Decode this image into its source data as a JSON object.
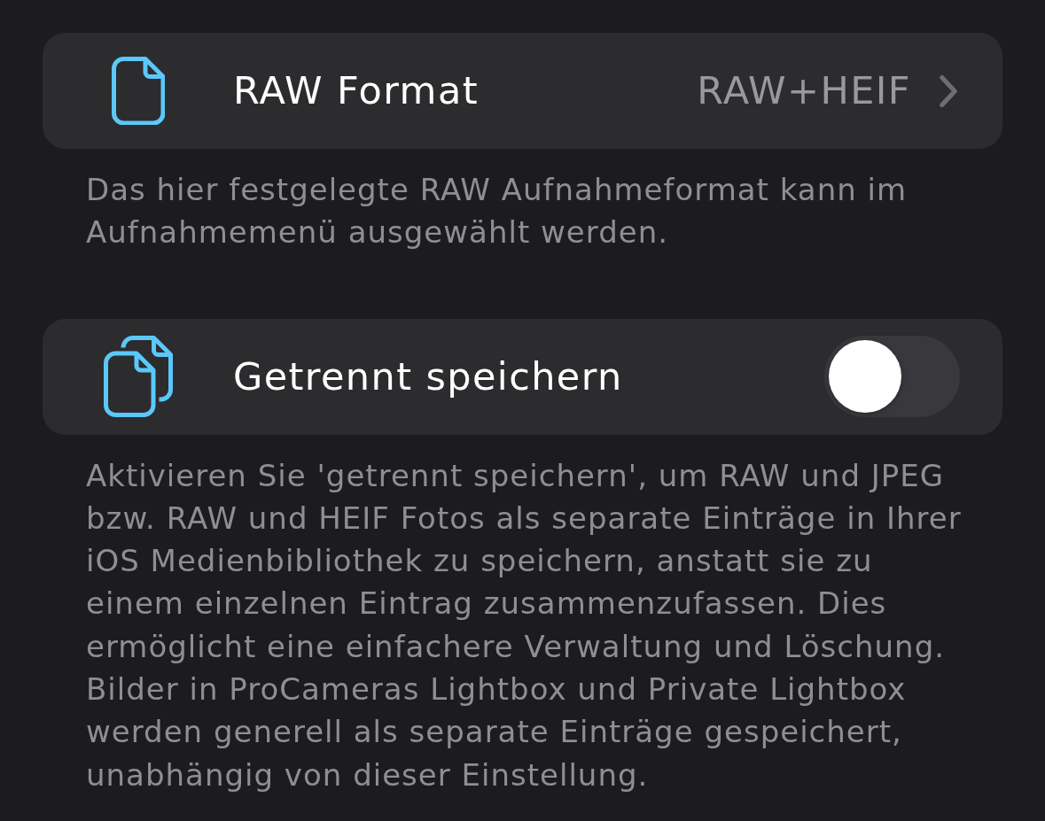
{
  "sections": [
    {
      "kind": "disclosure",
      "title": "RAW Format",
      "value": "RAW+HEIF",
      "footer": "Das hier festgelegte RAW Aufnahmeformat kann im Aufnahmemenü ausgewählt werden."
    },
    {
      "kind": "toggle",
      "title": "Getrennt speichern",
      "on": false,
      "footer": "Aktivieren Sie 'getrennt speichern', um RAW und JPEG bzw. RAW und HEIF Fotos als separate Einträge in Ihrer iOS Medienbibliothek zu speichern, anstatt sie zu einem einzelnen Eintrag zusammenzufassen. Dies ermöglicht eine einfachere Verwaltung und Löschung. Bilder in ProCameras Lightbox und Private Lightbox werden generell als separate Einträge gespeichert, unabhängig von dieser Einstellung."
    }
  ]
}
